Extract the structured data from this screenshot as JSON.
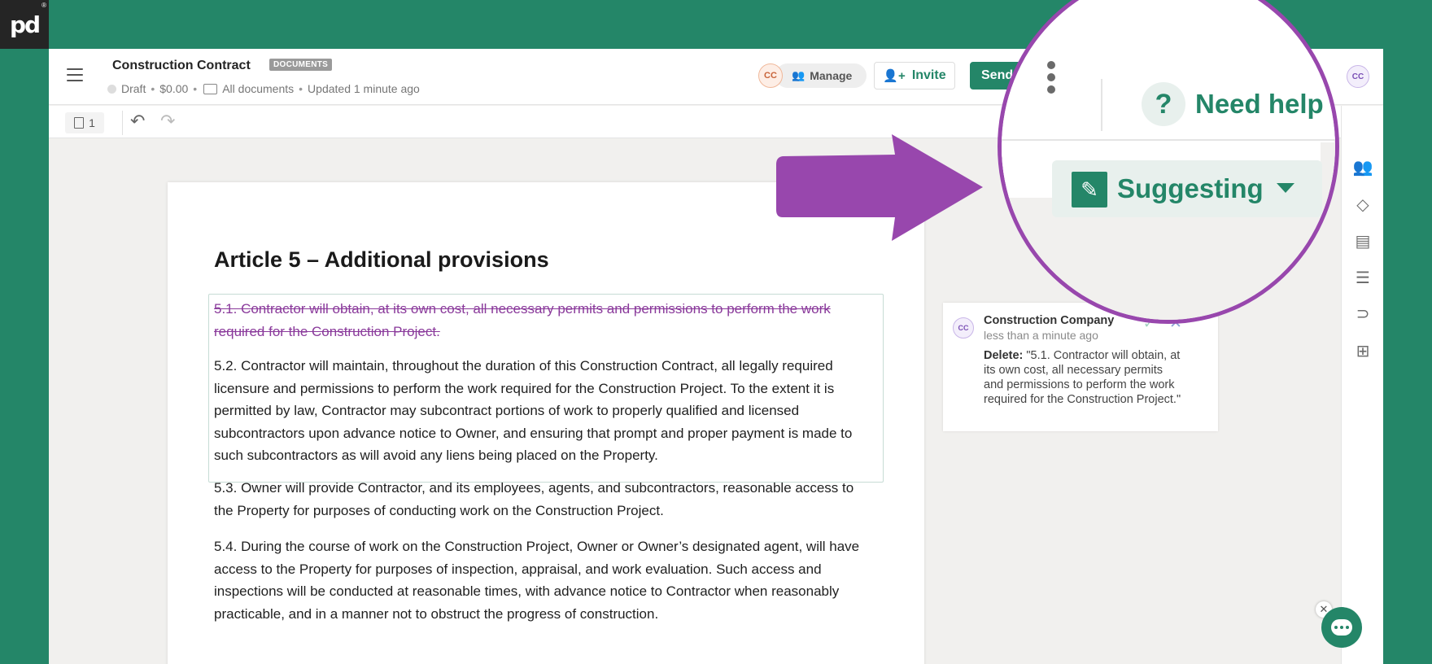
{
  "brand": {
    "logo_text": "pd",
    "registered_mark": "®"
  },
  "header": {
    "document_title": "Construction Contract",
    "document_tag": "DOCUMENTS",
    "status": "Draft",
    "amount": "$0.00",
    "folder": "All documents",
    "updated": "Updated 1 minute ago",
    "recipient_initials": "CC",
    "manage_label": "Manage",
    "invite_label": "Invite",
    "send_label": "Send",
    "user_initials": "CC"
  },
  "toolbar": {
    "page_count": "1"
  },
  "document": {
    "heading": "Article 5 – Additional provisions",
    "deleted_paragraph": "5.1. Contractor will obtain, at its own cost, all necessary permits and permissions to perform the work required for the Construction Project.",
    "paragraphs": [
      "5.2. Contractor will maintain, throughout the duration of this Construction Contract, all legally required licensure and permissions to perform the work required for the Construction Project. To the extent it is permitted by law, Contractor may subcontract portions of work to properly qualified and licensed subcontractors upon advance notice to Owner, and ensuring that prompt and proper payment is made to such subcontractors as will avoid any liens being placed on the Property.",
      "5.3. Owner will provide Contractor, and its employees, agents, and subcontractors, reasonable access to the Property for purposes of conducting work on the Construction Project.",
      "5.4. During the course of work on the Construction Project, Owner or Owner’s designated agent, will have access to the Property for purposes of inspection, appraisal, and work evaluation. Such access and inspections will be conducted at reasonable times, with advance notice to Contractor when reasonably practicable, and in a manner not to obstruct the progress of construction."
    ]
  },
  "comment": {
    "initials": "CC",
    "author": "Construction Company",
    "time": "less than a minute ago",
    "action_label": "Delete:",
    "quote": "\"5.1. Contractor will obtain, at its own cost, all necessary permits and permissions to perform the work required for the Construction Project.\""
  },
  "zoom_callout": {
    "help_label": "Need help",
    "help_glyph": "?",
    "mode_label": "Suggesting"
  },
  "rail_icons": [
    "people-icon",
    "shapes-icon",
    "form-icon",
    "database-icon",
    "paperclip-icon",
    "apps-icon"
  ],
  "colors": {
    "brand_green": "#248668",
    "highlight_purple": "#9847ad",
    "deleted_text": "#8a3a9b"
  }
}
